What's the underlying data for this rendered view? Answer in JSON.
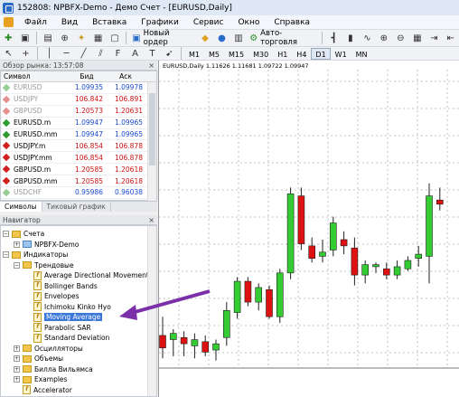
{
  "window": {
    "title": "152808: NPBFX-Demo - Демо Счет - [EURUSD,Daily]"
  },
  "menu": [
    "Файл",
    "Вид",
    "Вставка",
    "Графики",
    "Сервис",
    "Окно",
    "Справка"
  ],
  "toolbar": {
    "new_order": "Новый ордер",
    "autotrading": "Авто-торговля"
  },
  "timeframes": [
    "M1",
    "M5",
    "M15",
    "M30",
    "H1",
    "H4",
    "D1",
    "W1",
    "MN"
  ],
  "active_timeframe": "D1",
  "market_watch": {
    "title": "Обзор рынка: 13:57:08",
    "columns": [
      "Символ",
      "Бид",
      "Аск"
    ],
    "rows": [
      {
        "symbol": "EURUSD",
        "bid": "1.09935",
        "ask": "1.09978",
        "dim": true,
        "dir": "up"
      },
      {
        "symbol": "USDJPY",
        "bid": "106.842",
        "ask": "106.891",
        "dim": true,
        "dir": "down"
      },
      {
        "symbol": "GBPUSD",
        "bid": "1.20573",
        "ask": "1.20631",
        "dim": true,
        "dir": "down"
      },
      {
        "symbol": "EURUSD.m",
        "bid": "1.09947",
        "ask": "1.09965",
        "dim": false,
        "dir": "up"
      },
      {
        "symbol": "EURUSD.mm",
        "bid": "1.09947",
        "ask": "1.09965",
        "dim": false,
        "dir": "up"
      },
      {
        "symbol": "USDJPY.m",
        "bid": "106.854",
        "ask": "106.878",
        "dim": false,
        "dir": "down"
      },
      {
        "symbol": "USDJPY.mm",
        "bid": "106.854",
        "ask": "106.878",
        "dim": false,
        "dir": "down"
      },
      {
        "symbol": "GBPUSD.m",
        "bid": "1.20585",
        "ask": "1.20618",
        "dim": false,
        "dir": "down"
      },
      {
        "symbol": "GBPUSD.mm",
        "bid": "1.20585",
        "ask": "1.20618",
        "dim": false,
        "dir": "down"
      },
      {
        "symbol": "USDCHF",
        "bid": "0.95986",
        "ask": "0.96038",
        "dim": true,
        "dir": "up"
      }
    ],
    "tabs": [
      "Символы",
      "Тиковый график"
    ]
  },
  "navigator": {
    "title": "Навигатор",
    "items": [
      {
        "label": "Счета",
        "level": 0,
        "type": "folder",
        "pm": "-"
      },
      {
        "label": "NPBFX-Demo",
        "level": 1,
        "type": "account",
        "pm": "+"
      },
      {
        "label": "Индикаторы",
        "level": 0,
        "type": "folder",
        "pm": "-"
      },
      {
        "label": "Трендовые",
        "level": 1,
        "type": "folder",
        "pm": "-"
      },
      {
        "label": "Average Directional Movement",
        "level": 2,
        "type": "ind"
      },
      {
        "label": "Bollinger Bands",
        "level": 2,
        "type": "ind"
      },
      {
        "label": "Envelopes",
        "level": 2,
        "type": "ind"
      },
      {
        "label": "Ichimoku Kinko Hyo",
        "level": 2,
        "type": "ind"
      },
      {
        "label": "Moving Average",
        "level": 2,
        "type": "ind",
        "selected": true
      },
      {
        "label": "Parabolic SAR",
        "level": 2,
        "type": "ind"
      },
      {
        "label": "Standard Deviation",
        "level": 2,
        "type": "ind"
      },
      {
        "label": "Осцилляторы",
        "level": 1,
        "type": "folder",
        "pm": "+"
      },
      {
        "label": "Объемы",
        "level": 1,
        "type": "folder",
        "pm": "+"
      },
      {
        "label": "Билла Вильямса",
        "level": 1,
        "type": "folder",
        "pm": "+"
      },
      {
        "label": "Examples",
        "level": 1,
        "type": "folder",
        "pm": "+"
      },
      {
        "label": "Accelerator",
        "level": 1,
        "type": "ind"
      }
    ]
  },
  "chart": {
    "header": "EURUSD,Daily  1.11626 1.11681 1.09722 1.09947",
    "colors": {
      "bull": "#33cc33",
      "bear": "#dd1111",
      "grid": "#b0b0b0",
      "arrow": "#7b2fa8"
    }
  },
  "chart_data": {
    "type": "candlestick",
    "candles": [
      {
        "o": 1.0995,
        "h": 1.1004,
        "l": 1.0984,
        "c": 1.0989
      },
      {
        "o": 1.0993,
        "h": 1.0998,
        "l": 1.0985,
        "c": 1.0996
      },
      {
        "o": 1.0994,
        "h": 1.0997,
        "l": 1.0985,
        "c": 1.0991
      },
      {
        "o": 1.099,
        "h": 1.0996,
        "l": 1.0984,
        "c": 1.0993
      },
      {
        "o": 1.0992,
        "h": 1.0995,
        "l": 1.0985,
        "c": 1.0987
      },
      {
        "o": 1.0988,
        "h": 1.0993,
        "l": 1.0983,
        "c": 1.0991
      },
      {
        "o": 1.0994,
        "h": 1.1011,
        "l": 1.099,
        "c": 1.1007
      },
      {
        "o": 1.1006,
        "h": 1.1023,
        "l": 1.1003,
        "c": 1.1021
      },
      {
        "o": 1.1021,
        "h": 1.1023,
        "l": 1.1009,
        "c": 1.1011
      },
      {
        "o": 1.1011,
        "h": 1.102,
        "l": 1.1007,
        "c": 1.1018
      },
      {
        "o": 1.1017,
        "h": 1.1019,
        "l": 1.1003,
        "c": 1.1004
      },
      {
        "o": 1.1004,
        "h": 1.1027,
        "l": 1.1001,
        "c": 1.1025
      },
      {
        "o": 1.1025,
        "h": 1.1066,
        "l": 1.1022,
        "c": 1.1063
      },
      {
        "o": 1.1062,
        "h": 1.1066,
        "l": 1.1036,
        "c": 1.1039
      },
      {
        "o": 1.1038,
        "h": 1.1042,
        "l": 1.103,
        "c": 1.1032
      },
      {
        "o": 1.1033,
        "h": 1.1041,
        "l": 1.103,
        "c": 1.1035
      },
      {
        "o": 1.1036,
        "h": 1.1052,
        "l": 1.1033,
        "c": 1.1049
      },
      {
        "o": 1.1041,
        "h": 1.1045,
        "l": 1.1034,
        "c": 1.1038
      },
      {
        "o": 1.1037,
        "h": 1.1042,
        "l": 1.1019,
        "c": 1.1024
      },
      {
        "o": 1.1024,
        "h": 1.1031,
        "l": 1.102,
        "c": 1.1029
      },
      {
        "o": 1.1028,
        "h": 1.103,
        "l": 1.1025,
        "c": 1.1029
      },
      {
        "o": 1.1027,
        "h": 1.103,
        "l": 1.1022,
        "c": 1.1024
      },
      {
        "o": 1.1024,
        "h": 1.1031,
        "l": 1.1022,
        "c": 1.1028
      },
      {
        "o": 1.1027,
        "h": 1.1033,
        "l": 1.1026,
        "c": 1.1031
      },
      {
        "o": 1.1032,
        "h": 1.1038,
        "l": 1.1028,
        "c": 1.1034
      },
      {
        "o": 1.1033,
        "h": 1.1068,
        "l": 1.102,
        "c": 1.1062
      },
      {
        "o": 1.106,
        "h": 1.1066,
        "l": 1.1055,
        "c": 1.1058
      }
    ]
  }
}
